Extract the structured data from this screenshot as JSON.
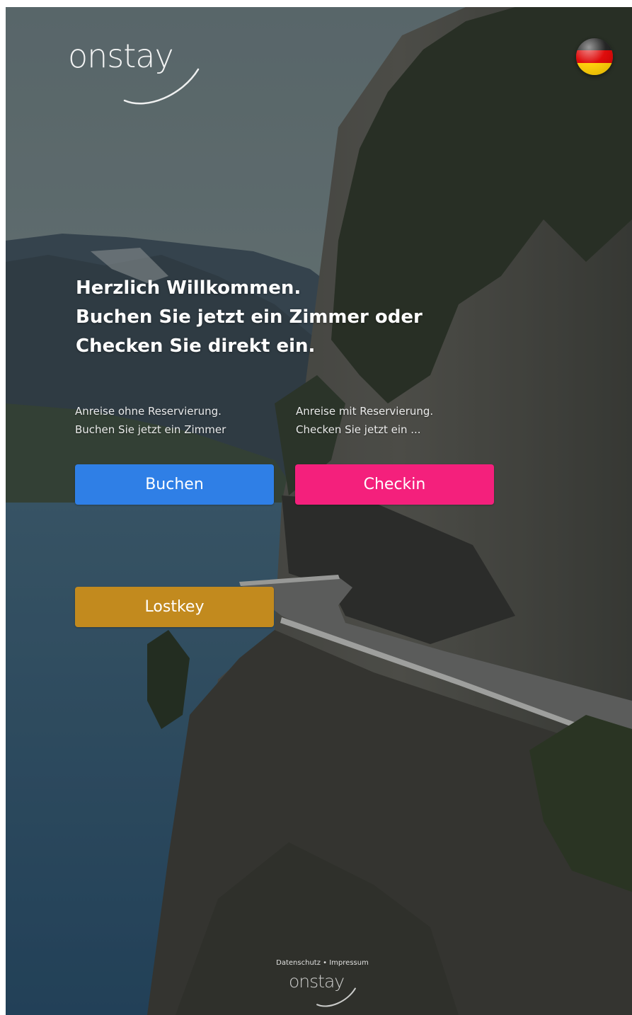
{
  "brand": {
    "logo_text": "onstay",
    "footer_logo_text": "onstay"
  },
  "language": {
    "icon": "german-flag-icon",
    "colors": [
      "#1a1a1a",
      "#dd0000",
      "#ffce00"
    ]
  },
  "welcome": {
    "lines": [
      "Herzlich Willkommen.",
      "Buchen Sie jetzt ein Zimmer oder",
      "Checken Sie direkt ein."
    ]
  },
  "booking": {
    "hint_lines": [
      "Anreise ohne Reservierung.",
      "Buchen Sie jetzt ein Zimmer"
    ],
    "button_label": "Buchen",
    "color": "#2f7fe6"
  },
  "checkin": {
    "hint_lines": [
      "Anreise mit Reservierung.",
      "Checken Sie jetzt ein ..."
    ],
    "button_label": "Checkin",
    "color": "#f4207c"
  },
  "lostkey": {
    "button_label": "Lostkey",
    "color": "#c28a1e"
  },
  "footer": {
    "privacy": "Datenschutz",
    "separator": "•",
    "imprint": "Impressum"
  }
}
